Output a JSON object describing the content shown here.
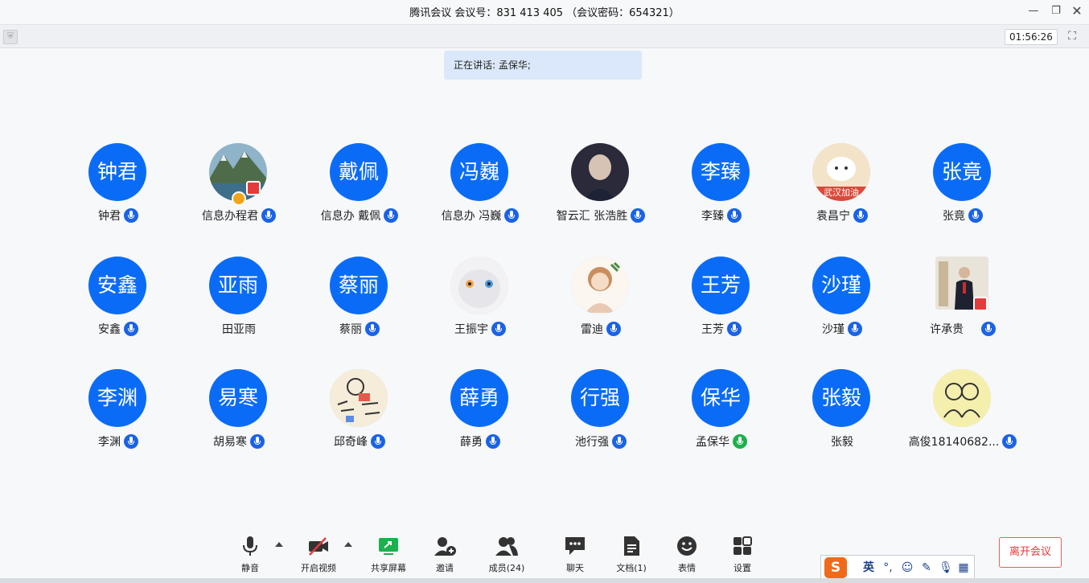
{
  "window": {
    "title": "腾讯会议  会议号：831 413 405 （会议密码：654321）",
    "timer": "01:56:26"
  },
  "speaking": {
    "text": "正在讲话: 孟保华;"
  },
  "participants": [
    {
      "avatar": "钟君",
      "name": "钟君"
    },
    {
      "avatar": "",
      "name": "信息办程君"
    },
    {
      "avatar": "戴佩",
      "name": "信息办 戴佩"
    },
    {
      "avatar": "冯巍",
      "name": "信息办  冯巍"
    },
    {
      "avatar": "",
      "name": "智云汇 张浩胜"
    },
    {
      "avatar": "李臻",
      "name": "李臻"
    },
    {
      "avatar": "",
      "name": "袁昌宁",
      "avatar_caption": "武汉加油"
    },
    {
      "avatar": "张竟",
      "name": "张竟"
    },
    {
      "avatar": "安鑫",
      "name": "安鑫"
    },
    {
      "avatar": "亚雨",
      "name": "田亚雨"
    },
    {
      "avatar": "蔡丽",
      "name": "蔡丽"
    },
    {
      "avatar": "",
      "name": "王振宇"
    },
    {
      "avatar": "",
      "name": "雷迪"
    },
    {
      "avatar": "王芳",
      "name": "王芳"
    },
    {
      "avatar": "沙瑾",
      "name": "沙瑾"
    },
    {
      "avatar": "",
      "name": "许承贵"
    },
    {
      "avatar": "李渊",
      "name": "李渊"
    },
    {
      "avatar": "易寒",
      "name": "胡易寒"
    },
    {
      "avatar": "",
      "name": "邱奇峰"
    },
    {
      "avatar": "薛勇",
      "name": "薛勇"
    },
    {
      "avatar": "行强",
      "name": "池行强"
    },
    {
      "avatar": "保华",
      "name": "孟保华"
    },
    {
      "avatar": "张毅",
      "name": "张毅"
    },
    {
      "avatar": "",
      "name": "高俊18140682..."
    }
  ],
  "toolbar": {
    "mute": "静音",
    "video": "开启视频",
    "share": "共享屏幕",
    "invite": "邀请",
    "members": "成员(24)",
    "chat": "聊天",
    "docs": "文档(1)",
    "emoji": "表情",
    "settings": "设置"
  },
  "leave_button": "离开会议",
  "ime": {
    "mode": "英"
  },
  "colors": {
    "accent": "#0a6cf6",
    "speaking": "#1bb14c",
    "leave": "#e23a3a"
  }
}
